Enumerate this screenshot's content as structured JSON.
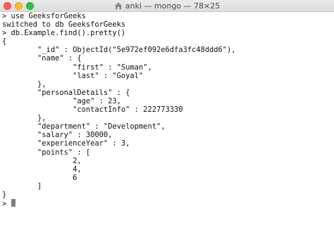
{
  "window": {
    "title": "anki — mongo — 78×25",
    "title_icon": "home-folder-icon"
  },
  "terminal": {
    "lines": [
      "> use GeeksforGeeks",
      "switched to db GeeksforGeeks",
      "> db.Example.find().pretty()",
      "{",
      "        \"_id\" : ObjectId(\"5e972ef092e6dfa3fc48ddd6\"),",
      "        \"name\" : {",
      "                \"first\" : \"Suman\",",
      "                \"last\" : \"Goyal\"",
      "        },",
      "        \"personalDetails\" : {",
      "                \"age\" : 23,",
      "                \"contactInfo\" : 222773330",
      "        },",
      "        \"department\" : \"Development\",",
      "        \"salary\" : 30000,",
      "        \"experienceYear\" : 3,",
      "        \"points\" : [",
      "                2,",
      "                4,",
      "                6",
      "        ]",
      "}"
    ],
    "prompt": "> "
  },
  "colors": {
    "background": "#ffffff",
    "text": "#111111",
    "cursor": "#7f7f7f",
    "titlebar": "#dcdcdc"
  }
}
